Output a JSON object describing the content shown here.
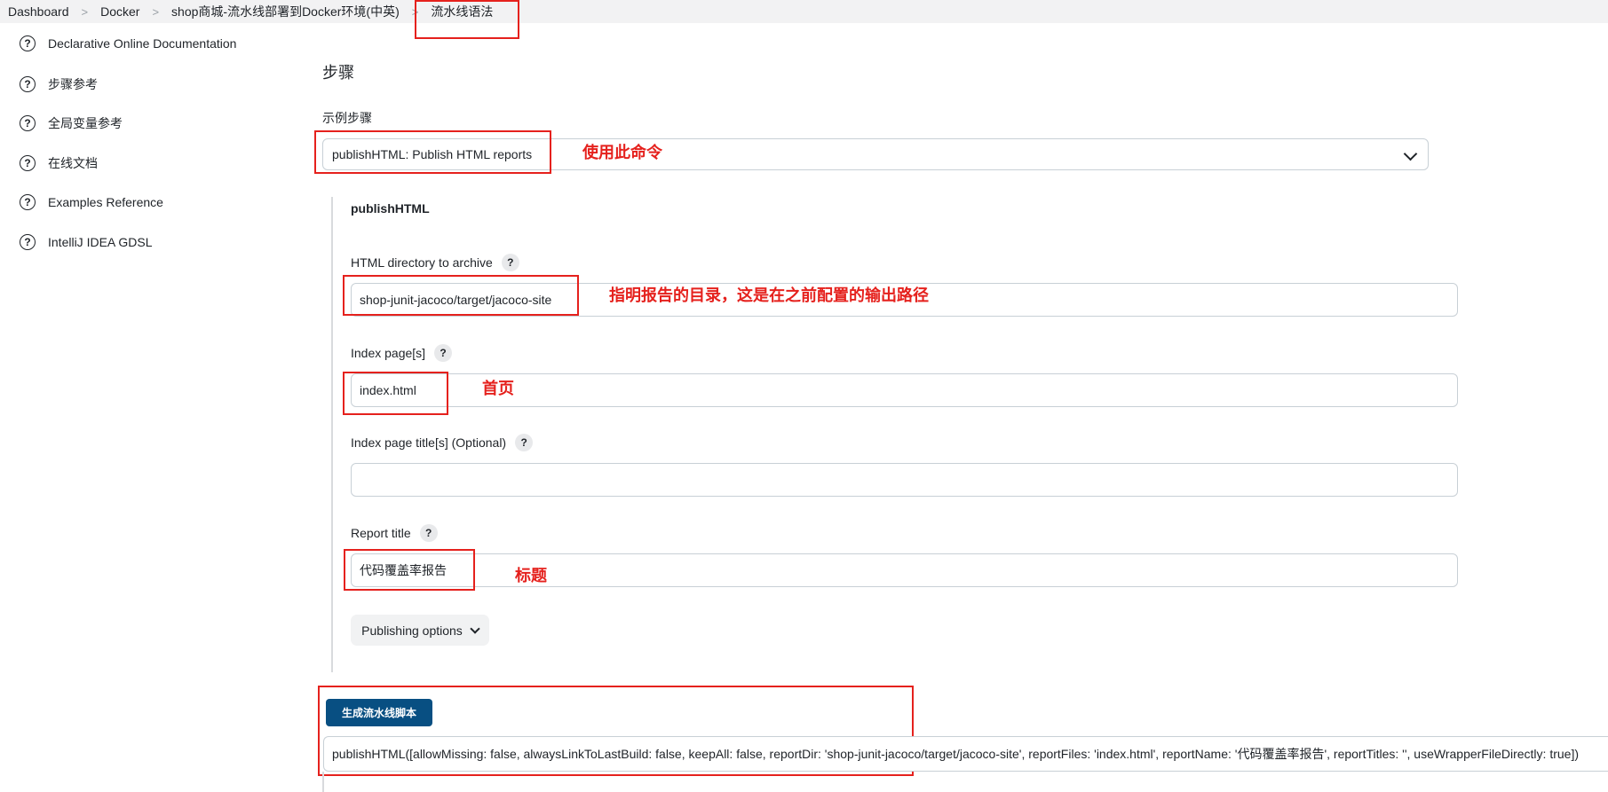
{
  "breadcrumb": {
    "items": [
      "Dashboard",
      "Docker",
      "shop商城-流水线部署到Docker环境(中英)",
      "流水线语法"
    ]
  },
  "sidebar": {
    "items": [
      {
        "label": "Declarative Online Documentation",
        "icon": "question-circle-icon"
      },
      {
        "label": "步骤参考",
        "icon": "question-circle-icon"
      },
      {
        "label": "全局变量参考",
        "icon": "question-circle-icon"
      },
      {
        "label": "在线文档",
        "icon": "question-circle-icon"
      },
      {
        "label": "Examples Reference",
        "icon": "question-circle-icon"
      },
      {
        "label": "IntelliJ IDEA GDSL",
        "icon": "question-circle-icon"
      }
    ]
  },
  "main": {
    "heading": "步骤",
    "sample_step_label": "示例步骤",
    "sample_step_value": "publishHTML: Publish HTML reports",
    "step_name": "publishHTML",
    "fields": {
      "html_dir": {
        "label": "HTML directory to archive",
        "value": "shop-junit-jacoco/target/jacoco-site"
      },
      "index_pages": {
        "label": "Index page[s]",
        "value": "index.html"
      },
      "index_titles": {
        "label": "Index page title[s] (Optional)",
        "value": ""
      },
      "report_title": {
        "label": "Report title",
        "value": "代码覆盖率报告"
      }
    },
    "help_glyph": "?",
    "publishing_options_label": "Publishing options",
    "generate_button_label": "生成流水线脚本",
    "generated_script": "publishHTML([allowMissing: false, alwaysLinkToLastBuild: false, keepAll: false, reportDir: 'shop-junit-jacoco/target/jacoco-site', reportFiles: 'index.html', reportName: '代码覆盖率报告', reportTitles: '', useWrapperFileDirectly: true])"
  },
  "annotations": {
    "use_command": "使用此命令",
    "report_dir": "指明报告的目录，这是在之前配置的输出路径",
    "index_page": "首页",
    "title": "标题"
  },
  "colors": {
    "annotation_red": "#e5211d",
    "primary_button": "#084f82"
  }
}
